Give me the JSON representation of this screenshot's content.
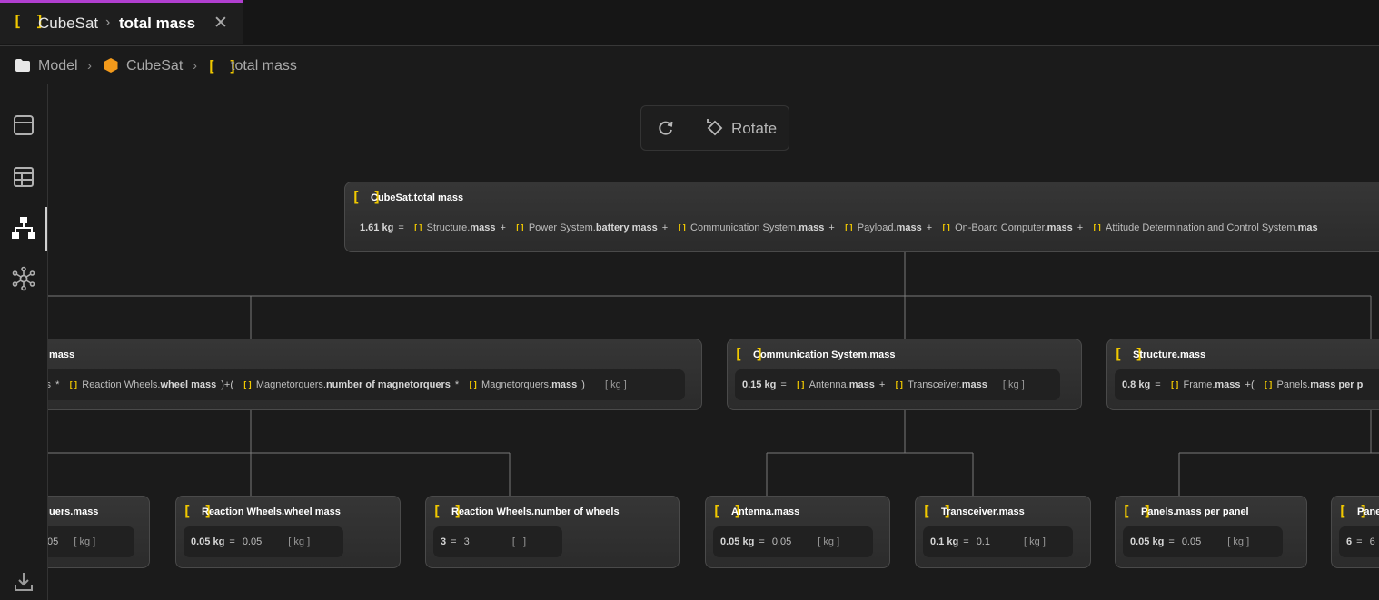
{
  "tab": {
    "parent": "CubeSat",
    "title": "total mass",
    "close": "✕"
  },
  "breadcrumb": {
    "items": [
      "Model",
      "CubeSat",
      "total mass"
    ]
  },
  "toolbar": {
    "rotate_label": "Rotate"
  },
  "nodes": {
    "root": {
      "title": "CubeSat.total mass",
      "value": "1.61 kg",
      "terms": [
        {
          "obj": "Structure",
          "prop": "mass"
        },
        {
          "obj": "Power System",
          "prop": "battery mass"
        },
        {
          "obj": "Communication System",
          "prop": "mass"
        },
        {
          "obj": "Payload",
          "prop": "mass"
        },
        {
          "obj": "On-Board Computer",
          "prop": "mass"
        },
        {
          "obj": "Attitude Determination and Control System",
          "prop": "mas"
        }
      ]
    },
    "adcs": {
      "title": "mass",
      "frag": "els",
      "t1_obj": "Reaction Wheels",
      "t1_prop": "wheel mass",
      "t2_obj": "Magnetorquers",
      "t2_prop": "number of magnetorquers",
      "t3_obj": "Magnetorquers",
      "t3_prop": "mass",
      "unit": "kg"
    },
    "comm": {
      "title": "Communication System.mass",
      "value": "0.15 kg",
      "t1_obj": "Antenna",
      "t1_prop": "mass",
      "t2_obj": "Transceiver",
      "t2_prop": "mass",
      "unit": "kg"
    },
    "struct": {
      "title": "Structure.mass",
      "value": "0.8 kg",
      "t1_obj": "Frame",
      "t1_prop": "mass",
      "t2_obj": "Panels",
      "t2_prop": "mass per p"
    },
    "mag": {
      "title": "uers.mass",
      "val": "05",
      "unit": "kg"
    },
    "rw_mass": {
      "title": "Reaction Wheels.wheel mass",
      "value": "0.05 kg",
      "val": "0.05",
      "unit": "kg"
    },
    "rw_num": {
      "title": "Reaction Wheels.number of wheels",
      "value": "3",
      "val": "3",
      "unit": ""
    },
    "antenna": {
      "title": "Antenna.mass",
      "value": "0.05 kg",
      "val": "0.05",
      "unit": "kg"
    },
    "transceiver": {
      "title": "Transceiver.mass",
      "value": "0.1 kg",
      "val": "0.1",
      "unit": "kg"
    },
    "panels_mpp": {
      "title": "Panels.mass per panel",
      "value": "0.05 kg",
      "val": "0.05",
      "unit": "kg"
    },
    "panels_n": {
      "title": "Pane",
      "value": "6",
      "val": "6"
    }
  },
  "colors": {
    "accent_tab": "#b13fd0",
    "bracket": "#f0c800",
    "cube_icon": "#f39a1b"
  }
}
